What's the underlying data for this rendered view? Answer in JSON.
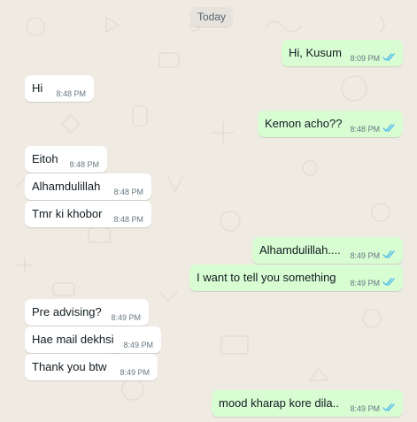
{
  "date_separator": "Today",
  "messages": [
    {
      "direction": "out",
      "text": "Hi, Kusum",
      "time": "8:09 PM",
      "status": "read"
    },
    {
      "direction": "in",
      "text": "Hi",
      "time": "8:48 PM"
    },
    {
      "direction": "out",
      "text": "Kemon acho??",
      "time": "8:48 PM",
      "status": "read"
    },
    {
      "direction": "in",
      "text": "Eitoh",
      "time": "8:48 PM"
    },
    {
      "direction": "in",
      "text": "Alhamdulillah",
      "time": "8:48 PM"
    },
    {
      "direction": "in",
      "text": "Tmr ki khobor",
      "time": "8:48 PM"
    },
    {
      "direction": "out",
      "text": "Alhamdulillah....",
      "time": "8:49 PM",
      "status": "read"
    },
    {
      "direction": "out",
      "text": "I want to tell you something",
      "time": "8:49 PM",
      "status": "read"
    },
    {
      "direction": "in",
      "text": "Pre advising?",
      "time": "8:49 PM"
    },
    {
      "direction": "in",
      "text": "Hae mail dekhsi",
      "time": "8:49 PM"
    },
    {
      "direction": "in",
      "text": "Thank you btw",
      "time": "8:49 PM"
    },
    {
      "direction": "out",
      "text": "mood kharap kore dila..",
      "time": "8:49 PM",
      "status": "read"
    }
  ],
  "colors": {
    "wallpaper": "#efeae2",
    "incoming_bubble": "#ffffff",
    "outgoing_bubble": "#d9fdd3",
    "read_ticks": "#53bdeb",
    "timestamp": "#667781"
  },
  "icons": {
    "read_status": "double-check-icon"
  }
}
